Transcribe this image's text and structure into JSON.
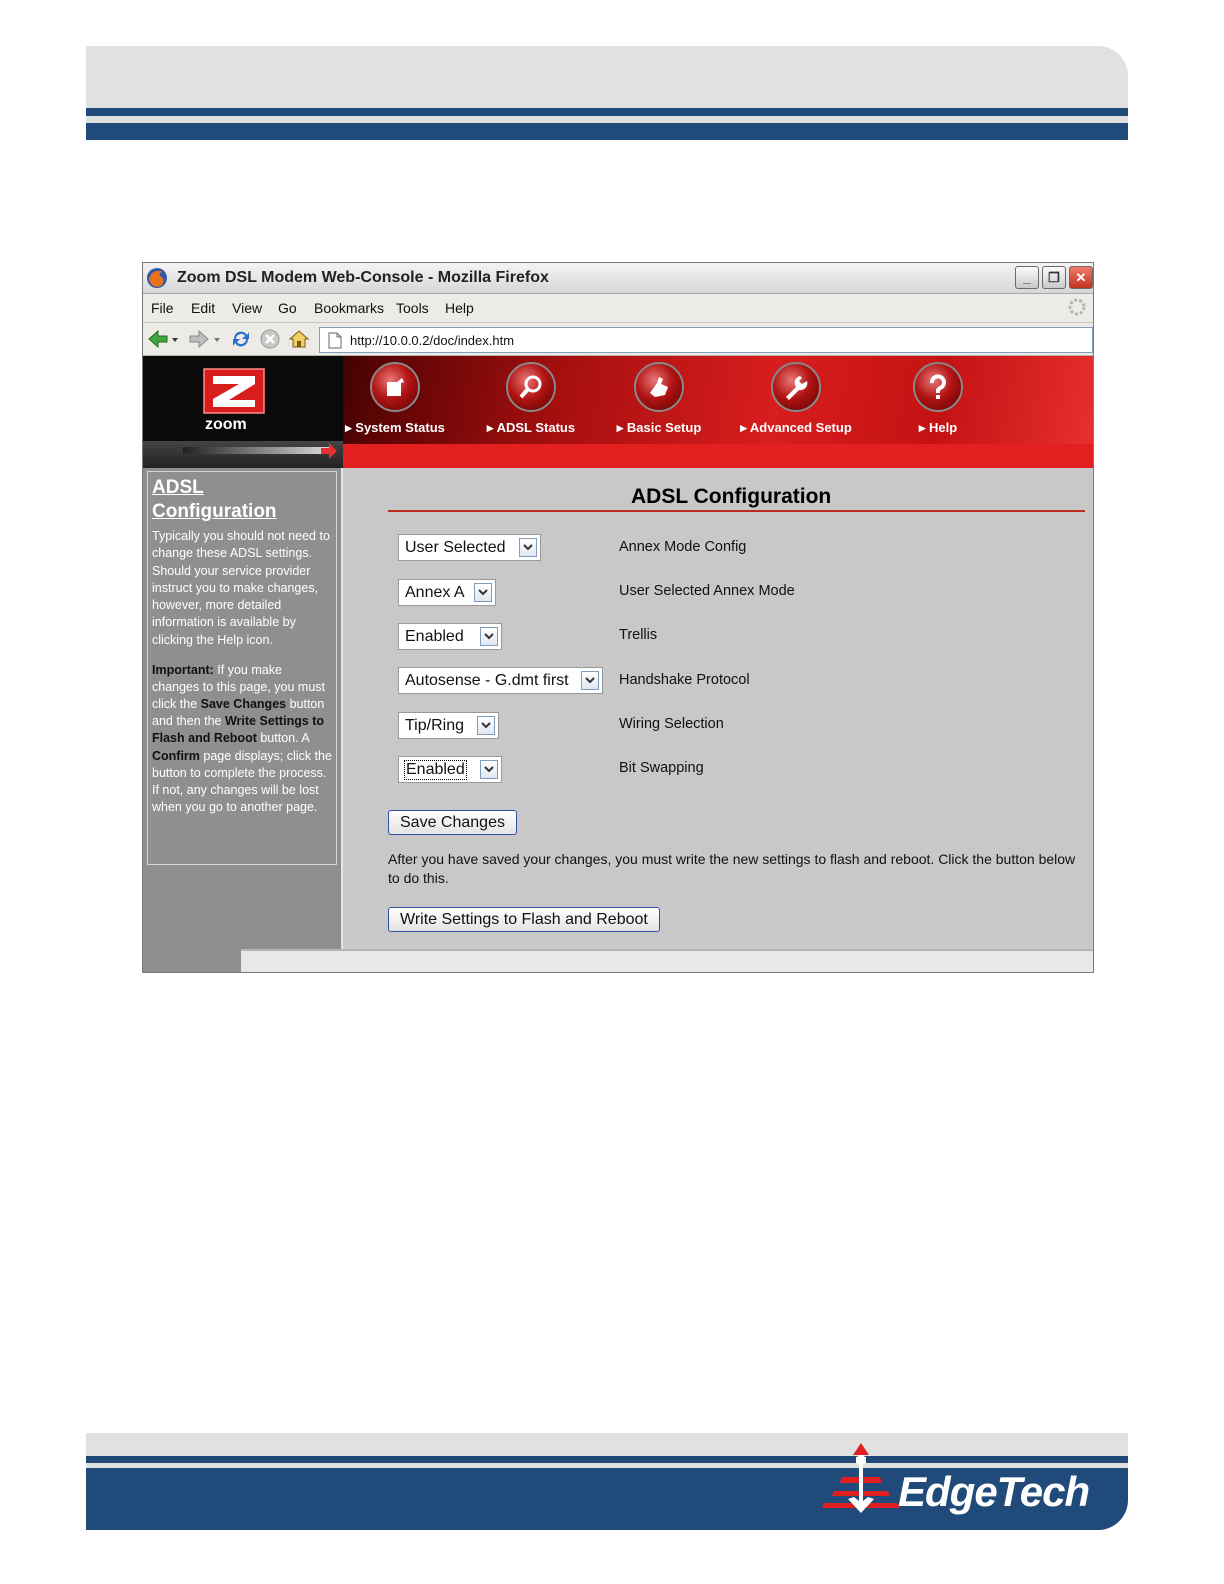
{
  "window": {
    "title": "Zoom DSL Modem Web-Console - Mozilla Firefox",
    "buttons": {
      "minimize": "_",
      "restore": "❐",
      "close": "✕"
    }
  },
  "menu": [
    "File",
    "Edit",
    "View",
    "Go",
    "Bookmarks",
    "Tools",
    "Help"
  ],
  "address": {
    "url": "http://10.0.0.2/doc/index.htm"
  },
  "banner": {
    "logo_text": "zoom",
    "nav": [
      {
        "label": "System Status",
        "icon": "system-status-icon"
      },
      {
        "label": "ADSL Status",
        "icon": "magnifier-icon"
      },
      {
        "label": "Basic Setup",
        "icon": "pointer-hand-icon"
      },
      {
        "label": "Advanced Setup",
        "icon": "wrench-icon"
      },
      {
        "label": "Help",
        "icon": "question-icon"
      }
    ],
    "nav_marker": "▸"
  },
  "sidebar": {
    "title_line1": "ADSL",
    "title_line2": "Configuration",
    "intro": "Typically you should not need to change these ADSL settings. Should your service provider instruct you to make changes, however, more detailed information is available by clicking the Help icon.",
    "important_label": "Important:",
    "important_1": " If you make changes to this page, you must click the ",
    "save_ref": "Save Changes",
    "important_2": " button and then the ",
    "write_ref": "Write Settings to Flash and Reboot",
    "important_3": " button. A ",
    "confirm_ref": "Confirm",
    "important_4": " page displays; click the button to complete the process. If not, any changes will be lost when you go to another page."
  },
  "main": {
    "heading": "ADSL Configuration",
    "settings": [
      {
        "value": "User Selected",
        "label": "Annex Mode Config"
      },
      {
        "value": "Annex A",
        "label": "User Selected Annex Mode"
      },
      {
        "value": "Enabled",
        "label": "Trellis"
      },
      {
        "value": "Autosense - G.dmt first",
        "label": "Handshake Protocol"
      },
      {
        "value": "Tip/Ring",
        "label": "Wiring Selection"
      },
      {
        "value": "Enabled",
        "label": "Bit Swapping"
      }
    ],
    "save_button": "Save Changes",
    "note": "After you have saved your changes, you must write the new settings to flash and reboot. Click the button below to do this.",
    "write_button": "Write Settings to Flash and Reboot"
  },
  "footer": {
    "brand": "EdgeTech"
  },
  "colors": {
    "band_blue": "#1f4a7a",
    "band_grey": "#e1e1e1",
    "zoom_red": "#d81d1d",
    "rule_red": "#c02a20"
  }
}
